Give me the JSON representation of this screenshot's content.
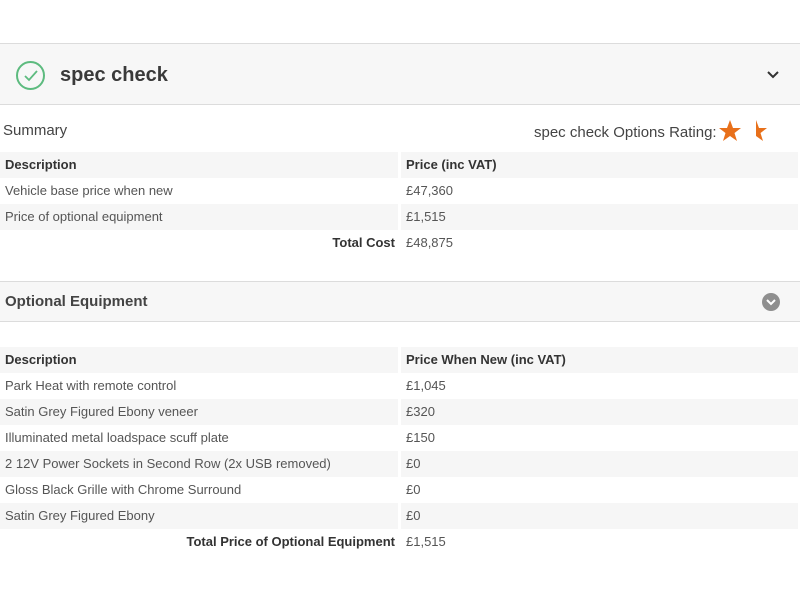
{
  "header": {
    "title": "spec check",
    "icon": "check-circle-icon",
    "toggle_icon": "chevron-down-icon"
  },
  "summary": {
    "label": "Summary",
    "rating_label": "spec check Options Rating:",
    "rating_stars": 1.5,
    "rating_max_stars_shown": 2,
    "star_color": "#e8701a",
    "columns": [
      "Description",
      "Price (inc VAT)"
    ],
    "rows": [
      [
        "Vehicle base price when new",
        "£47,360"
      ],
      [
        "Price of optional equipment",
        "£1,515"
      ]
    ],
    "total_label": "Total Cost",
    "total_value": "£48,875"
  },
  "optional": {
    "title": "Optional Equipment",
    "toggle_icon": "chevron-down-circle-icon",
    "columns": [
      "Description",
      "Price When New (inc VAT)"
    ],
    "rows": [
      [
        "Park Heat with remote control",
        "£1,045"
      ],
      [
        "Satin Grey Figured Ebony veneer",
        "£320"
      ],
      [
        "Illuminated metal loadspace scuff plate",
        "£150"
      ],
      [
        "2 12V Power Sockets in Second Row (2x USB removed)",
        "£0"
      ],
      [
        "Gloss Black Grille with Chrome Surround",
        "£0"
      ],
      [
        "Satin Grey Figured Ebony",
        "£0"
      ]
    ],
    "total_label": "Total Price of Optional Equipment",
    "total_value": "£1,515"
  },
  "colors": {
    "accent_green": "#5dbb7f",
    "star_orange": "#e8701a",
    "row_shade": "#f6f6f6"
  }
}
